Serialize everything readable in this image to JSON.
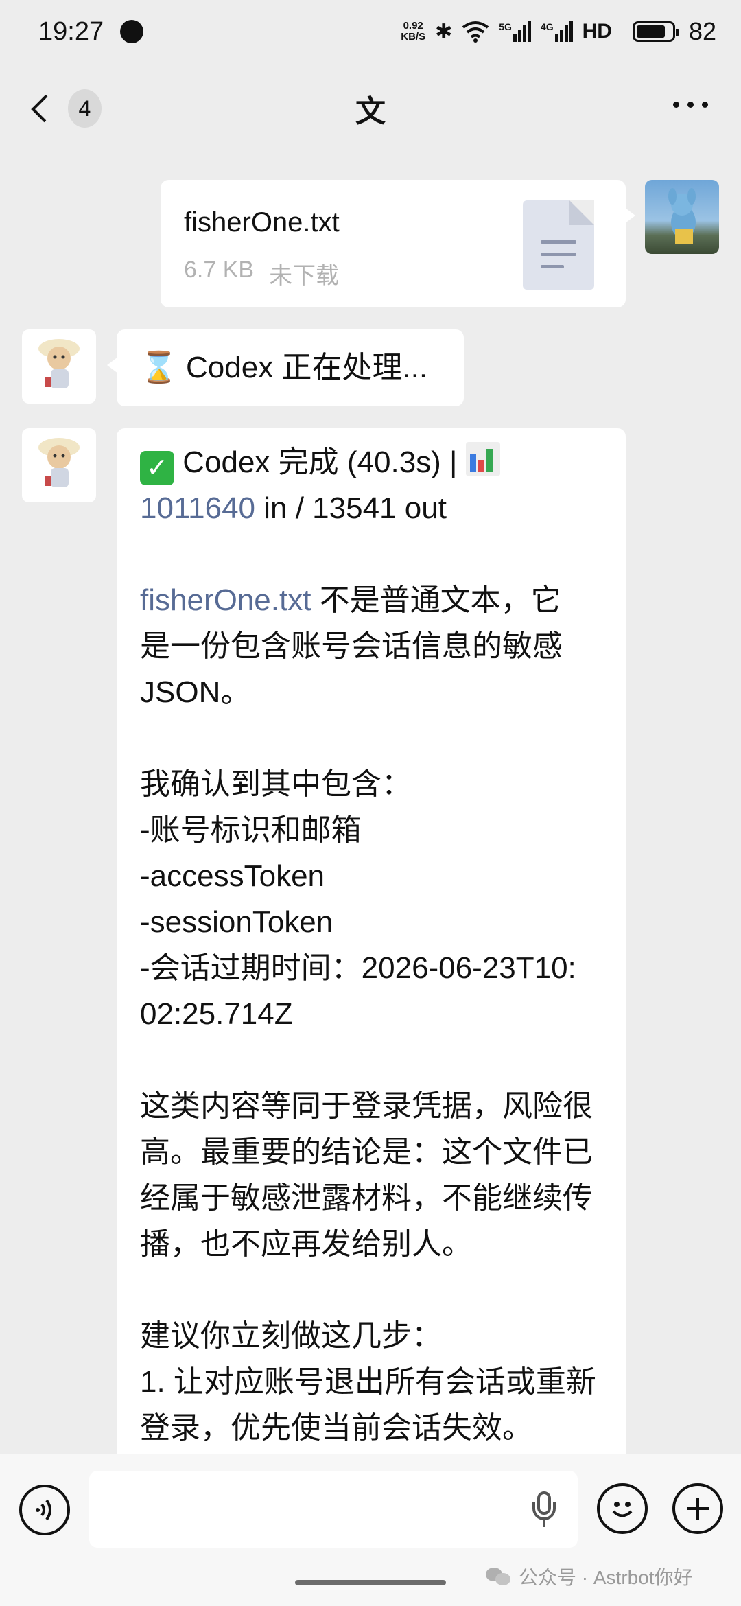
{
  "status_bar": {
    "time": "19:27",
    "net_speed_value": "0.92",
    "net_speed_unit": "KB/S",
    "network_labels": [
      "5G",
      "4G",
      "HD"
    ],
    "battery": "82",
    "battery_level": 0.82
  },
  "nav": {
    "unread_count": "4",
    "title": "文"
  },
  "file_message": {
    "name": "fisherOne.txt",
    "size": "6.7 KB",
    "status": "未下载"
  },
  "processing_message": {
    "text": "Codex 正在处理..."
  },
  "result_message": {
    "header_text": "Codex 完成 (40.3s) |",
    "tokens_in": "1011640",
    "tokens_rest": " in / 13541 out",
    "file_link": "fisherOne.txt",
    "intro_rest": " 不是普通文本，它",
    "intro_line2": "是一份包含账号会话信息的敏感",
    "intro_line3": "JSON。",
    "confirm_title": "我确认到其中包含：",
    "item_1": "-账号标识和邮箱",
    "item_2": "-accessToken",
    "item_3": "-sessionToken",
    "item_4_line1": "-会话过期时间：2026-06-23T10:",
    "item_4_line2": "02:25.714Z",
    "risk_line1": "这类内容等同于登录凭据，风险很",
    "risk_line2": "高。最重要的结论是：这个文件已",
    "risk_line3": "经属于敏感泄露材料，不能继续传",
    "risk_line4": "播，也不应再发给别人。",
    "advice_title": "建议你立刻做这几步：",
    "step_1_line1": "1. 让对应账号退出所有会话或重新",
    "step_1_line2": "登录，优先使当前会话失效。"
  },
  "watermark": {
    "text": "公众号 · Astrbot你好"
  },
  "icons": {
    "processing": "hourglass-icon",
    "done": "check-mark-icon",
    "stats": "bar-chart-icon"
  },
  "colors": {
    "link": "#576b95",
    "check_green": "#2fb344",
    "background": "#ededed"
  }
}
